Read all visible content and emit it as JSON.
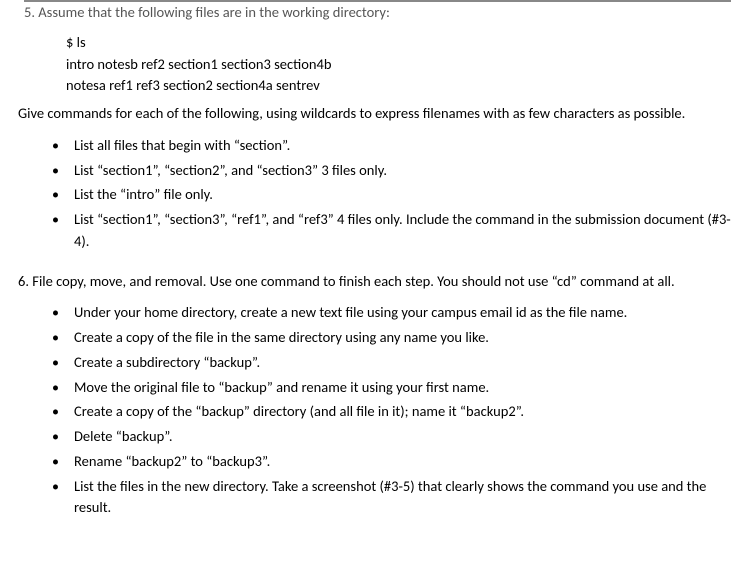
{
  "q5": {
    "title": "5. Assume that the following files are in the working directory:",
    "prompt": "$ ls",
    "files_line1": "intro notesb ref2 section1 section3 section4b",
    "files_line2": "notesa ref1 ref3 section2 section4a sentrev",
    "instruction": "Give commands for each of the following, using wildcards to express filenames with as few characters as possible.",
    "bullets": [
      "List all files that begin with “section”.",
      "List “section1”, “section2”, and “section3” 3 files only.",
      "List the “intro” file only.",
      "List “section1”, “section3”, “ref1”, and “ref3” 4 files only. Include the command in the submission document (#3-4)."
    ]
  },
  "q6": {
    "title": "6. File copy, move, and removal. Use one command to finish each step. You should not use “cd” command at all.",
    "bullets": [
      "Under your home directory, create a new text file using your campus email id as the file name.",
      "Create a copy of the file in the same directory using any name you like.",
      "Create a subdirectory “backup”.",
      "Move the original file to “backup” and rename it using your first name.",
      "Create a copy of the “backup” directory (and all file in it); name it “backup2”.",
      "Delete “backup”.",
      "Rename “backup2” to “backup3”.",
      "List the files in the new directory. Take a screenshot (#3-5) that clearly shows the command you use and the result."
    ]
  }
}
